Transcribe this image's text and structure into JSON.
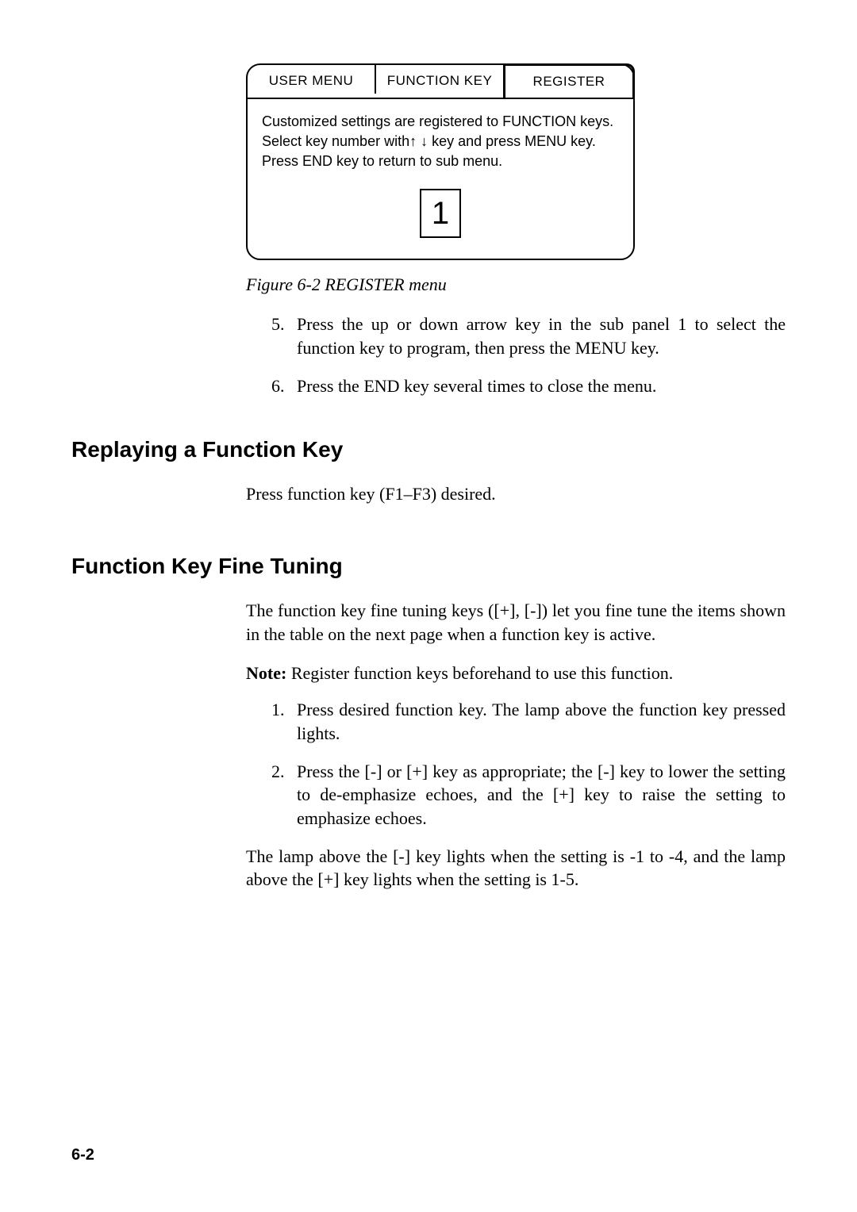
{
  "figure": {
    "tabs": [
      "USER MENU",
      "FUNCTION  KEY",
      "REGISTER"
    ],
    "body_line1": "Customized settings are registered to FUNCTION keys.",
    "body_line2_a": "Select key number with",
    "body_line2_b": " key and press MENU key.",
    "body_line3": "Press END key to return to sub menu.",
    "key_number": "1",
    "caption": "Figure 6-2 REGISTER menu"
  },
  "list1": {
    "n5": "5.",
    "t5": "Press the up or down arrow key in the sub panel 1 to select the function key to program, then press the MENU key.",
    "n6": "6.",
    "t6": "Press the END key several times to close the menu."
  },
  "heading_replay": "Replaying a Function Key",
  "replay_text": "Press function key (F1–F3) desired.",
  "heading_tuning": "Function Key Fine Tuning",
  "tuning_intro": "The function key fine tuning keys ([+], [-]) let you fine tune the items shown in the table on the next page when a function key is active.",
  "note_label": "Note:",
  "note_text": "Register function keys beforehand to use this function.",
  "list2": {
    "n1": "1.",
    "t1": "Press desired function key. The lamp above the function key pressed lights.",
    "n2": "2.",
    "t2": "Press the [-] or [+] key as appropriate; the [-] key to lower the setting to de-emphasize echoes, and the [+] key to raise the setting to emphasize echoes."
  },
  "tuning_outro": "The lamp above the [-] key lights when the setting is -1 to -4, and the lamp above the [+] key lights when the setting is 1-5.",
  "page_number": "6-2"
}
